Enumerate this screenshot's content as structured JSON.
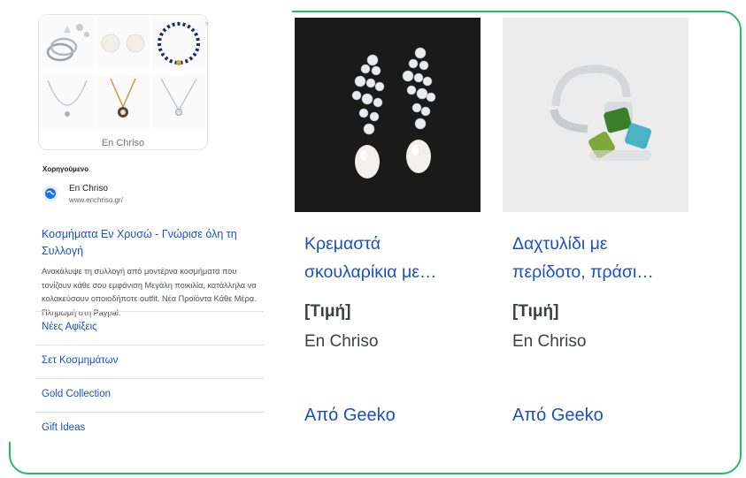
{
  "ad": {
    "ad_choices_icon": "ad-choices-icon",
    "grid_caption": "En Chriso",
    "sponsored_label": "Χορηγούμενο",
    "advertiser_name": "En Chriso",
    "advertiser_url": "www.enchriso.gr/",
    "headline": "Κοσμήματα Εν Χρυσώ - Γνώρισε όλη τη Συλλογή",
    "description": "Ανακάλυψε τη συλλογή από μοντέρνα κοσμήματα που τονίζουν κάθε σου εμφάνιση Μεγάλη ποικιλία, κατάλληλα να κολακεύσουν οποιοδήποτε outfit. Νέα Προϊόντα Κάθε Μέρα. Πληρωμή στη Paypal.",
    "sitelinks": [
      "Νέες Αφίξεις",
      "Σετ Κοσμημάτων",
      "Gold Collection",
      "Gift Ideas"
    ]
  },
  "products": [
    {
      "title": "Κρεμαστά σκουλαρίκια με…",
      "price": "[Τιμή]",
      "merchant": "En Chriso",
      "via": "Από Geeko",
      "image": "pearl-drop-earrings"
    },
    {
      "title": "Δαχτυλίδι με περίδοτο, πράσι…",
      "price": "[Τιμή]",
      "merchant": "En Chriso",
      "via": "Από Geeko",
      "image": "peridot-ring"
    }
  ],
  "colors": {
    "link": "#1a4fc4",
    "frame": "#1fbf5f"
  }
}
